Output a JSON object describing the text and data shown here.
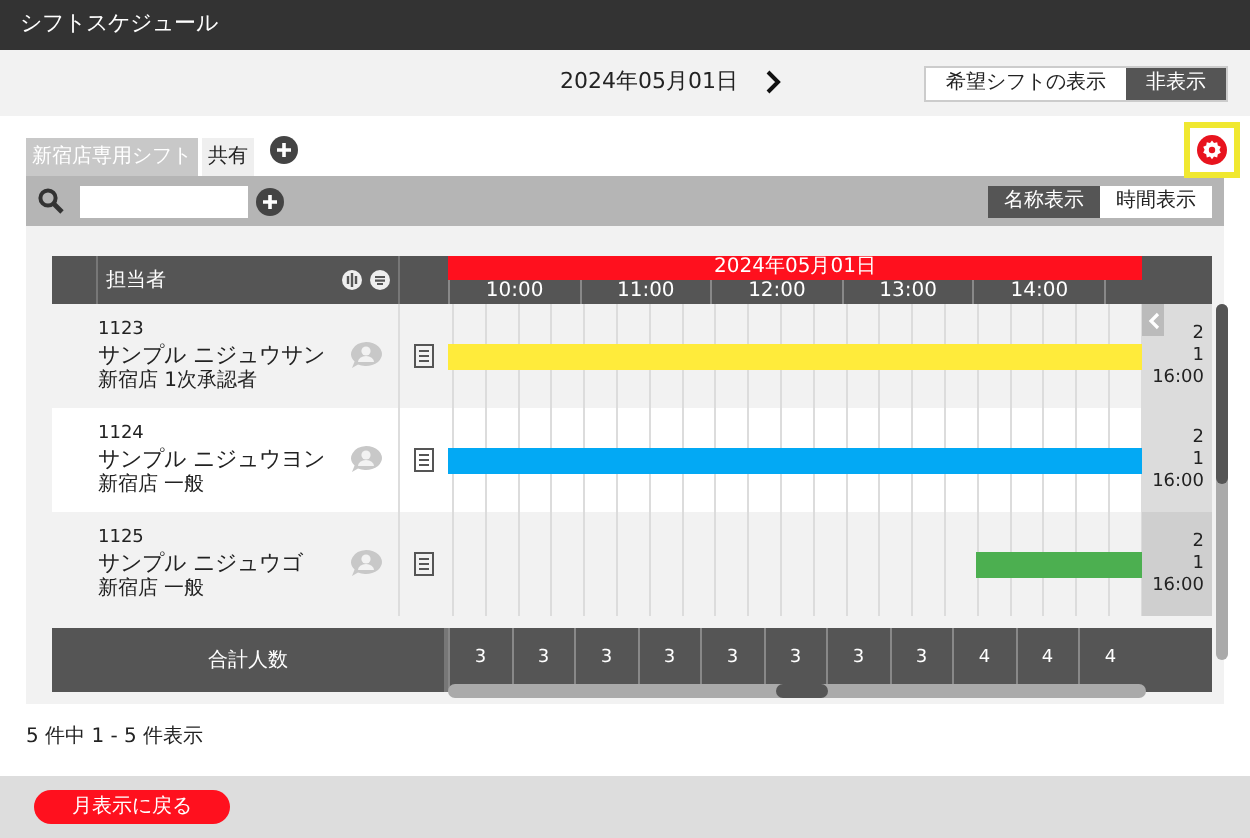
{
  "window": {
    "title": "シフトスケジュール"
  },
  "date_bar": {
    "date": "2024年05月01日",
    "wish_shift": [
      {
        "label": "希望シフトの表示",
        "selected": false
      },
      {
        "label": "非表示",
        "selected": true
      }
    ]
  },
  "tabs": [
    {
      "label": "新宿店専用シフト",
      "selected": true
    },
    {
      "label": "共有",
      "selected": false
    }
  ],
  "view_toggle": [
    {
      "label": "名称表示",
      "selected": true
    },
    {
      "label": "時間表示",
      "selected": false
    }
  ],
  "table": {
    "staff_header": "担当者",
    "date": "2024年05月01日",
    "times": [
      "10:00",
      "11:00",
      "12:00",
      "13:00",
      "14:00"
    ],
    "rows": [
      {
        "id": "1123",
        "name": "サンプル ニジュウサン",
        "role": "新宿店 1次承認者",
        "bar": {
          "color": "#ffeb3b",
          "level": 1
        },
        "summary": [
          "2",
          "1",
          "16:00"
        ]
      },
      {
        "id": "1124",
        "name": "サンプル ニジュウヨン",
        "role": "新宿店 一般",
        "bar": {
          "color": "#03a9f4",
          "level": 1
        },
        "summary": [
          "2",
          "1",
          "16:00"
        ]
      },
      {
        "id": "1125",
        "name": "サンプル ニジュウゴ",
        "role": "新宿店 一般",
        "bar": {
          "color": "#4caf50",
          "level": 0.24
        },
        "summary": [
          "2",
          "1",
          "16:00"
        ]
      }
    ],
    "total": {
      "label": "合計人数",
      "values": [
        "3",
        "3",
        "3",
        "3",
        "3",
        "3",
        "3",
        "3",
        "4",
        "4",
        "4"
      ]
    }
  },
  "pagination": "5 件中 1 - 5 件表示",
  "back_button": "月表示に戻る"
}
